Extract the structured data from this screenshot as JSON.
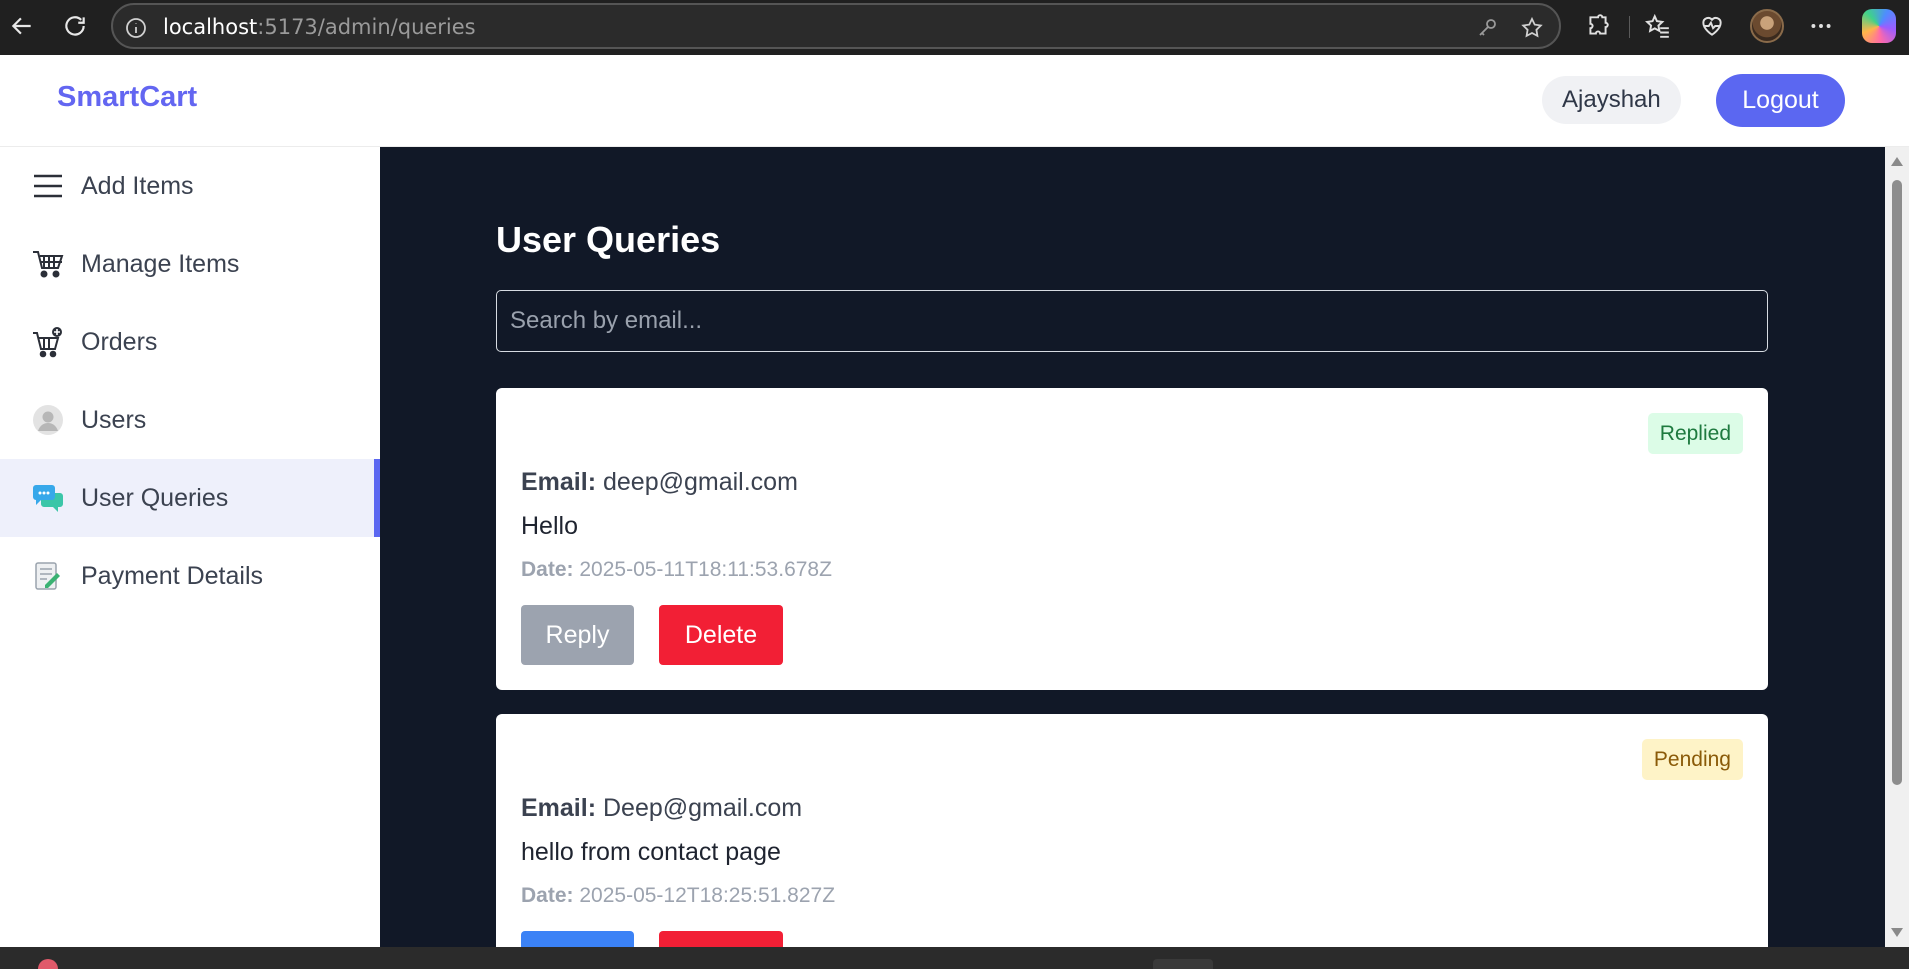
{
  "browser": {
    "url_host": "localhost",
    "url_path": ":5173/admin/queries"
  },
  "header": {
    "brand": "SmartCart",
    "username": "Ajayshah",
    "logout_label": "Logout"
  },
  "sidebar": {
    "items": [
      {
        "label": "Add Items",
        "icon": "hamburger-menu-icon"
      },
      {
        "label": "Manage Items",
        "icon": "shopping-cart-icon"
      },
      {
        "label": "Orders",
        "icon": "cart-add-icon"
      },
      {
        "label": "Users",
        "icon": "user-avatar-icon"
      },
      {
        "label": "User Queries",
        "icon": "chat-bubble-icon",
        "active": true
      },
      {
        "label": "Payment Details",
        "icon": "payment-form-icon"
      }
    ]
  },
  "main": {
    "title": "User Queries",
    "search_placeholder": "Search by email...",
    "email_label": "Email:",
    "date_label": "Date:",
    "reply_label": "Reply",
    "delete_label": "Delete",
    "queries": [
      {
        "status": "Replied",
        "email": "deep@gmail.com",
        "message": "Hello",
        "date": "2025-05-11T18:11:53.678Z"
      },
      {
        "status": "Pending",
        "email": "Deep@gmail.com",
        "message": "hello from contact page",
        "date": "2025-05-12T18:25:51.827Z"
      }
    ]
  },
  "colors": {
    "brand": "#6366f1",
    "main_bg": "#111827",
    "replied_badge": "#dcfce7",
    "pending_badge": "#fef3c7",
    "delete": "#f21f35",
    "reply_disabled": "#9ca3af",
    "reply_active": "#3b82f6"
  }
}
